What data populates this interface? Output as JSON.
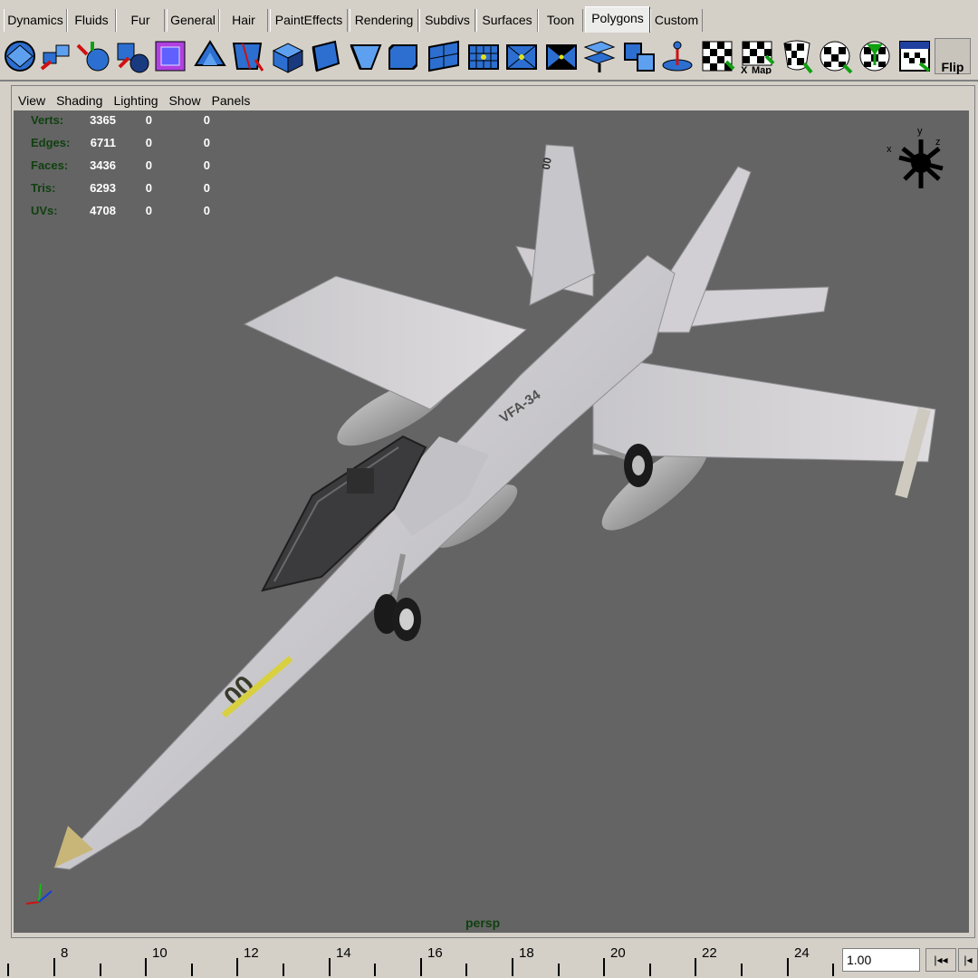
{
  "shelf": {
    "tabs": [
      "Dynamics",
      "Fluids",
      "Fur",
      "General",
      "Hair",
      "PaintEffects",
      "Rendering",
      "Subdivs",
      "Surfaces",
      "Toon",
      "Polygons",
      "Custom"
    ],
    "active_tab": "Polygons",
    "flip_label": "Flip",
    "map_label": "Map"
  },
  "panel": {
    "menu": [
      "View",
      "Shading",
      "Lighting",
      "Show",
      "Panels"
    ],
    "camera": "persp",
    "heads_up": [
      {
        "label": "Verts:",
        "v1": "3365",
        "v2": "0",
        "v3": "0"
      },
      {
        "label": "Edges:",
        "v1": "6711",
        "v2": "0",
        "v3": "0"
      },
      {
        "label": "Faces:",
        "v1": "3436",
        "v2": "0",
        "v3": "0"
      },
      {
        "label": "Tris:",
        "v1": "6293",
        "v2": "0",
        "v3": "0"
      },
      {
        "label": "UVs:",
        "v1": "4708",
        "v2": "0",
        "v3": "0"
      }
    ],
    "view_cube_axes": {
      "x": "x",
      "y": "y",
      "z": "z"
    }
  },
  "model": {
    "tail_marking": "00",
    "nose_marking": "00",
    "fuselage_marking": "VFA-34"
  },
  "timeline": {
    "labels": [
      "8",
      "10",
      "12",
      "14",
      "16",
      "18",
      "20",
      "22",
      "24"
    ],
    "current_time": "1.00",
    "rewind_label": "|◂◂",
    "step_label": "|◂"
  },
  "colors": {
    "viewport_bg": "#646464",
    "hud_label": "#104010",
    "hud_value": "#ffffff",
    "ui_bg": "#d4d0c8"
  }
}
